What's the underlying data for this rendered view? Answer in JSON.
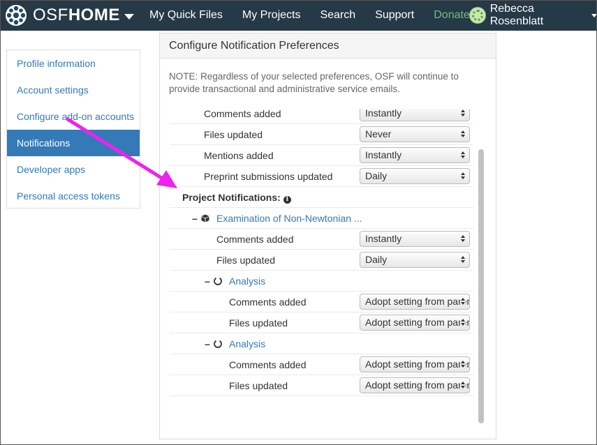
{
  "navbar": {
    "brand_osf": "OSF",
    "brand_home": "HOME",
    "links": [
      "My Quick Files",
      "My Projects",
      "Search",
      "Support",
      "Donate"
    ],
    "user_name": "Rebecca Rosenblatt",
    "background": "#263947",
    "donate_color": "#6ac47e"
  },
  "sidebar": {
    "items": [
      "Profile information",
      "Account settings",
      "Configure add-on accounts",
      "Notifications",
      "Developer apps",
      "Personal access tokens"
    ],
    "active_index": 3,
    "accent": "#337ab7"
  },
  "panel": {
    "title": "Configure Notification Preferences",
    "note": "NOTE: Regardless of your selected preferences, OSF will continue to provide transactional and administrative service emails."
  },
  "global_rows": [
    {
      "label": "Comments added",
      "value": "Instantly"
    },
    {
      "label": "Files updated",
      "value": "Never"
    },
    {
      "label": "Mentions added",
      "value": "Instantly"
    },
    {
      "label": "Preprint submissions updated",
      "value": "Daily"
    }
  ],
  "project_section": {
    "heading": "Project Notifications:",
    "project": {
      "toggle": "–",
      "title": "Examination of Non-Newtonian ...",
      "rows": [
        {
          "label": "Comments added",
          "value": "Instantly"
        },
        {
          "label": "Files updated",
          "value": "Daily"
        }
      ]
    },
    "components": [
      {
        "toggle": "–",
        "title": "Analysis",
        "rows": [
          {
            "label": "Comments added",
            "value": "Adopt setting from parent project"
          },
          {
            "label": "Files updated",
            "value": "Adopt setting from parent project"
          }
        ]
      },
      {
        "toggle": "–",
        "title": "Analysis",
        "rows": [
          {
            "label": "Comments added",
            "value": "Adopt setting from parent project"
          },
          {
            "label": "Files updated",
            "value": "Adopt setting from parent project"
          }
        ]
      }
    ]
  },
  "icons": {
    "brand": "osf-logo-icon",
    "project": "cube-icon",
    "component": "circle-notch-icon",
    "info": "info-icon"
  },
  "annotation_arrow_color": "#ee22ee"
}
